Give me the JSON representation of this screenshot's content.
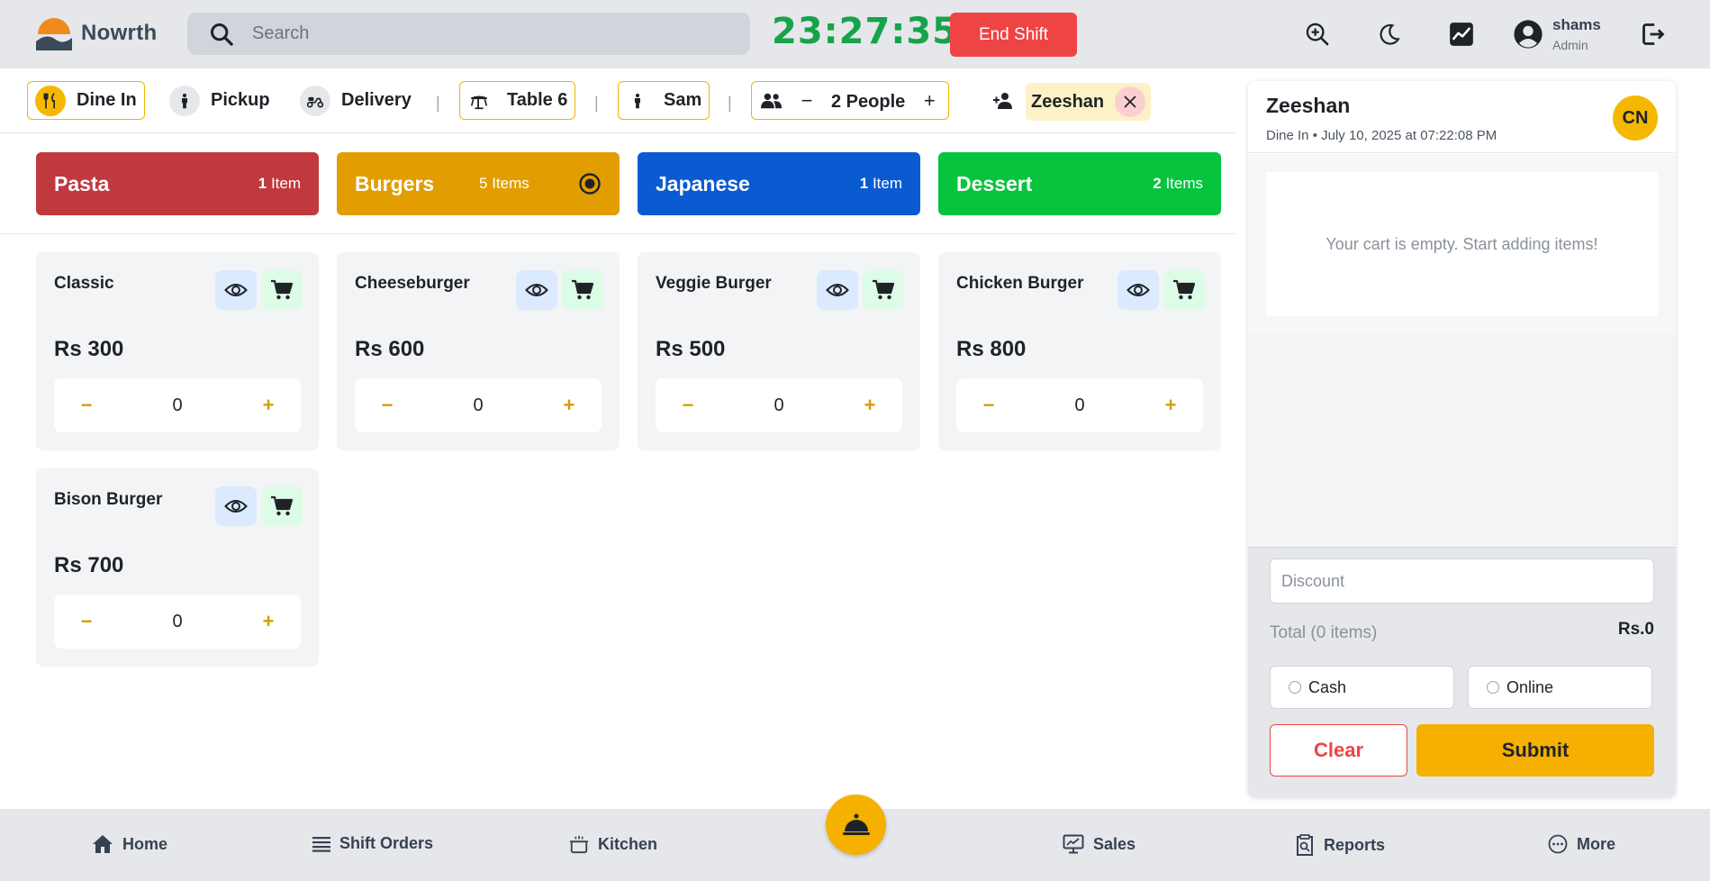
{
  "brand": {
    "name": "Nowrth"
  },
  "header": {
    "search_placeholder": "Search",
    "clock": "23:27:35",
    "end_shift_label": "End Shift",
    "user": {
      "name": "shams",
      "role": "Admin"
    }
  },
  "order_types": [
    {
      "label": "Dine In",
      "icon": "utensils-icon",
      "selected": true
    },
    {
      "label": "Pickup",
      "icon": "person-icon",
      "selected": false
    },
    {
      "label": "Delivery",
      "icon": "scooter-icon",
      "selected": false
    }
  ],
  "order_context": {
    "table": "Table 6",
    "waiter": "Sam",
    "people": "2 People",
    "customer": "Zeeshan"
  },
  "categories": [
    {
      "name": "Pasta",
      "count_num": "1",
      "count_unit": "Item",
      "color": "#c0393f"
    },
    {
      "name": "Burgers",
      "count_num": "5",
      "count_unit": "Items",
      "color": "#e29d00",
      "active": true
    },
    {
      "name": "Japanese",
      "count_num": "1",
      "count_unit": "Item",
      "color": "#0a5bd1"
    },
    {
      "name": "Dessert",
      "count_num": "2",
      "count_unit": "Items",
      "color": "#07c43f"
    }
  ],
  "products": [
    {
      "name": "Classic",
      "price": "Rs 300",
      "qty": "0"
    },
    {
      "name": "Cheeseburger",
      "price": "Rs 600",
      "qty": "0"
    },
    {
      "name": "Veggie Burger",
      "price": "Rs 500",
      "qty": "0"
    },
    {
      "name": "Chicken Burger",
      "price": "Rs 800",
      "qty": "0"
    },
    {
      "name": "Bison Burger",
      "price": "Rs 700",
      "qty": "0"
    }
  ],
  "cart": {
    "customer": "Zeeshan",
    "meta": "Dine In • July 10, 2025 at 07:22:08 PM",
    "avatar_initials": "CN",
    "empty_message": "Your cart is empty. Start adding items!",
    "discount_placeholder": "Discount",
    "total_label": "Total (0 items)",
    "total_value": "Rs.0",
    "payment_methods": [
      "Cash",
      "Online"
    ],
    "clear_label": "Clear",
    "submit_label": "Submit"
  },
  "bottom_nav": [
    {
      "label": "Home",
      "icon": "home-icon"
    },
    {
      "label": "Shift Orders",
      "icon": "list-icon"
    },
    {
      "label": "Kitchen",
      "icon": "pot-icon"
    },
    {
      "label": "Sales",
      "icon": "chart-monitor-icon"
    },
    {
      "label": "Reports",
      "icon": "clipboard-search-icon"
    },
    {
      "label": "More",
      "icon": "more-icon"
    }
  ],
  "colors": {
    "accent": "#f5b000",
    "clock": "#16a34a",
    "danger": "#ef4444"
  }
}
